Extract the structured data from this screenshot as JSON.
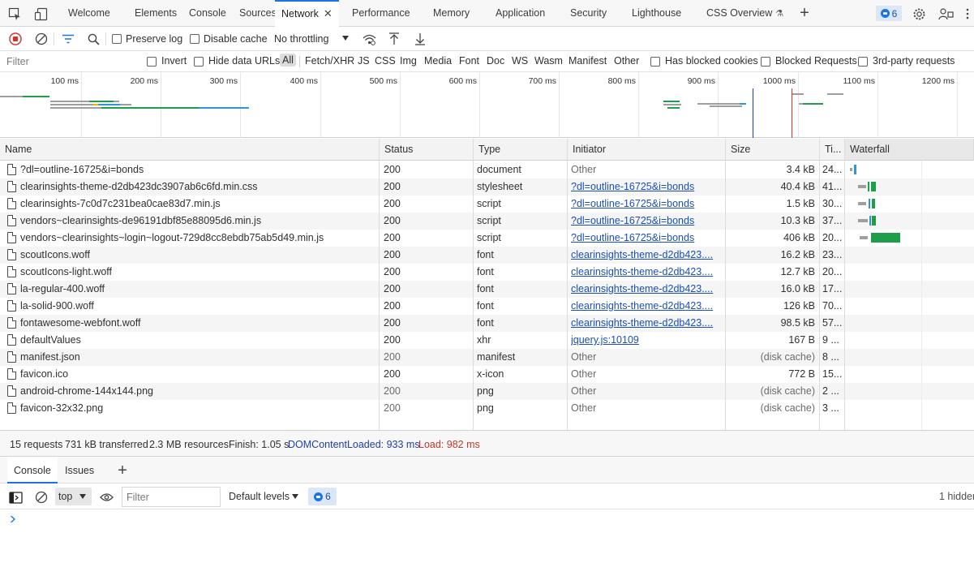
{
  "tabs": [
    {
      "label": "Welcome"
    },
    {
      "label": "Elements"
    },
    {
      "label": "Console"
    },
    {
      "label": "Sources"
    },
    {
      "label": "Network",
      "active": true
    },
    {
      "label": "Performance"
    },
    {
      "label": "Memory"
    },
    {
      "label": "Application"
    },
    {
      "label": "Security"
    },
    {
      "label": "Lighthouse"
    },
    {
      "label": "CSS Overview"
    }
  ],
  "header_badges": {
    "messages_count": "6"
  },
  "toolbar": {
    "preserve_log": "Preserve log",
    "disable_cache": "Disable cache",
    "throttling": "No throttling"
  },
  "filter": {
    "placeholder": "Filter",
    "invert": "Invert",
    "hide_data_urls": "Hide data URLs",
    "types": [
      "All",
      "Fetch/XHR",
      "JS",
      "CSS",
      "Img",
      "Media",
      "Font",
      "Doc",
      "WS",
      "Wasm",
      "Manifest",
      "Other"
    ],
    "has_blocked_cookies": "Has blocked cookies",
    "blocked_requests": "Blocked Requests",
    "third_party": "3rd-party requests"
  },
  "overview": {
    "ticks": [
      "100 ms",
      "200 ms",
      "300 ms",
      "400 ms",
      "500 ms",
      "600 ms",
      "700 ms",
      "800 ms",
      "900 ms",
      "1000 ms",
      "1100 ms",
      "1200 ms"
    ],
    "domcontentloaded_ms": 933,
    "load_ms": 982
  },
  "columns": {
    "name": "Name",
    "status": "Status",
    "type": "Type",
    "initiator": "Initiator",
    "size": "Size",
    "time": "Ti...",
    "waterfall": "Waterfall"
  },
  "requests": [
    {
      "name": "?dl=outline-16725&i=bonds",
      "status": "200",
      "type": "document",
      "initiator": "Other",
      "initiator_link": false,
      "size": "3.4 kB",
      "time": "24..."
    },
    {
      "name": "clearinsights-theme-d2db423dc3907ab6c6fd.min.css",
      "status": "200",
      "type": "stylesheet",
      "initiator": "?dl=outline-16725&i=bonds",
      "initiator_link": true,
      "size": "40.4 kB",
      "time": "41..."
    },
    {
      "name": "clearinsights-7c0d7c231bea0cae83d7.min.js",
      "status": "200",
      "type": "script",
      "initiator": "?dl=outline-16725&i=bonds",
      "initiator_link": true,
      "size": "1.5 kB",
      "time": "30..."
    },
    {
      "name": "vendors~clearinsights-de96191dbf85e88095d6.min.js",
      "status": "200",
      "type": "script",
      "initiator": "?dl=outline-16725&i=bonds",
      "initiator_link": true,
      "size": "10.3 kB",
      "time": "37..."
    },
    {
      "name": "vendors~clearinsights~login~logout-729d8cc8ebdb75ab5d49.min.js",
      "status": "200",
      "type": "script",
      "initiator": "?dl=outline-16725&i=bonds",
      "initiator_link": true,
      "size": "406 kB",
      "time": "20..."
    },
    {
      "name": "scoutIcons.woff",
      "status": "200",
      "type": "font",
      "initiator": "clearinsights-theme-d2db423....",
      "initiator_link": true,
      "size": "16.2 kB",
      "time": "23..."
    },
    {
      "name": "scoutIcons-light.woff",
      "status": "200",
      "type": "font",
      "initiator": "clearinsights-theme-d2db423....",
      "initiator_link": true,
      "size": "12.7 kB",
      "time": "20..."
    },
    {
      "name": "la-regular-400.woff",
      "status": "200",
      "type": "font",
      "initiator": "clearinsights-theme-d2db423....",
      "initiator_link": true,
      "size": "16.0 kB",
      "time": "17..."
    },
    {
      "name": "la-solid-900.woff",
      "status": "200",
      "type": "font",
      "initiator": "clearinsights-theme-d2db423....",
      "initiator_link": true,
      "size": "126 kB",
      "time": "70..."
    },
    {
      "name": "fontawesome-webfont.woff",
      "status": "200",
      "type": "font",
      "initiator": "clearinsights-theme-d2db423....",
      "initiator_link": true,
      "size": "98.5 kB",
      "time": "57..."
    },
    {
      "name": "defaultValues",
      "status": "200",
      "type": "xhr",
      "initiator": "jquery.js:10109",
      "initiator_link": true,
      "size": "167 B",
      "time": "9 ..."
    },
    {
      "name": "manifest.json",
      "status": "200",
      "type": "manifest",
      "initiator": "Other",
      "initiator_link": false,
      "size": "(disk cache)",
      "time": "8 ..."
    },
    {
      "name": "favicon.ico",
      "status": "200",
      "type": "x-icon",
      "initiator": "Other",
      "initiator_link": false,
      "size": "772 B",
      "time": "15..."
    },
    {
      "name": "android-chrome-144x144.png",
      "status": "200",
      "type": "png",
      "initiator": "Other",
      "initiator_link": false,
      "size": "(disk cache)",
      "time": "2 ..."
    },
    {
      "name": "favicon-32x32.png",
      "status": "200",
      "type": "png",
      "initiator": "Other",
      "initiator_link": false,
      "size": "(disk cache)",
      "time": "3 ..."
    }
  ],
  "summary": {
    "requests": "15 requests",
    "transferred": "731 kB transferred",
    "resources": "2.3 MB resources",
    "finish": "Finish: 1.05 s",
    "domcontentloaded": "DOMContentLoaded: 933 ms",
    "load": "Load: 982 ms"
  },
  "drawer": {
    "tabs": [
      "Console",
      "Issues"
    ],
    "context": "top",
    "filter_placeholder": "Filter",
    "levels": "Default levels",
    "message_count": "6",
    "hidden": "1 hidden"
  },
  "colors": {
    "accent": "#1a73e8",
    "domcontentloaded_line": "#1f3fa8",
    "load_line": "#c0392b",
    "waiting": "#9e9e9e",
    "downloading": "#1e9e4a",
    "ttfb": "#2f96d6"
  }
}
